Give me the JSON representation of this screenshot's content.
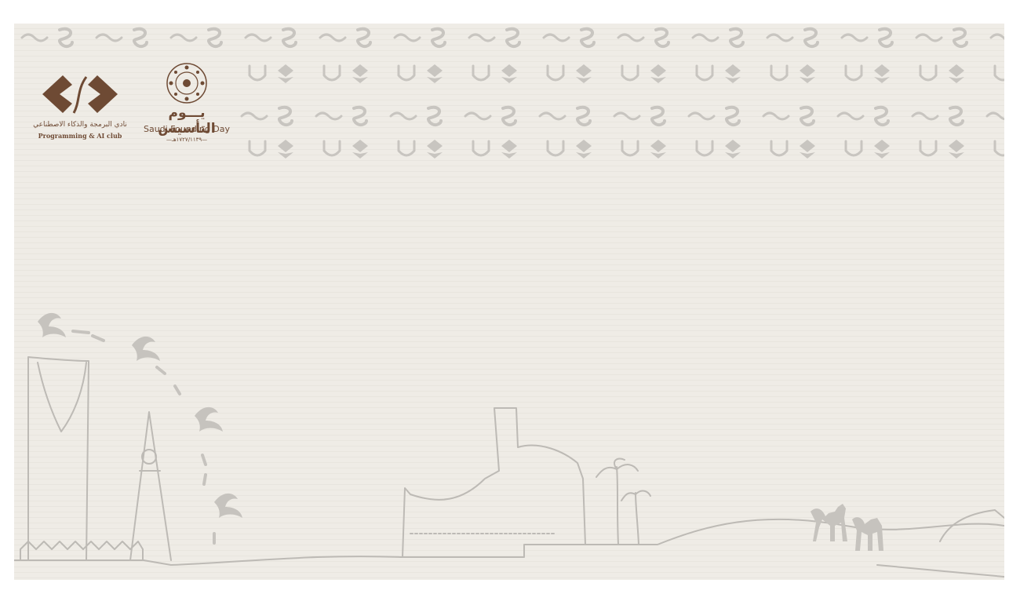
{
  "logos": {
    "club": {
      "arabic_name": "نادي البرمجة والذكاء الاصطناعي",
      "english_name": "Programming & AI club"
    },
    "founding_day": {
      "arabic_title": "يـــوم التأسيس",
      "english_title": "Saudi Founding Day",
      "years": "—١٧٢٧/١١٣٩هـ—"
    }
  },
  "colors": {
    "background": "#efece6",
    "pattern_gray": "#c8c5c0",
    "logo_brown": "#6e4a34",
    "line_art": "#bdbab5"
  }
}
